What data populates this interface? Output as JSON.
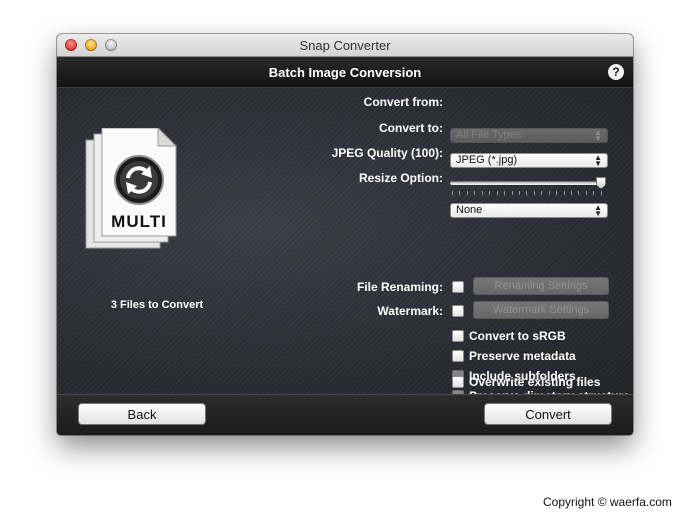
{
  "window": {
    "title": "Snap Converter"
  },
  "header": {
    "title": "Batch Image Conversion",
    "help_label": "?"
  },
  "form": {
    "convert_from": {
      "label": "Convert from:",
      "value": "All File Types"
    },
    "convert_to": {
      "label": "Convert to:",
      "value": "JPEG (*.jpg)"
    },
    "jpeg_quality": {
      "label": "JPEG Quality (100):",
      "value": 100
    },
    "resize_option": {
      "label": "Resize Option:",
      "value": "None"
    },
    "file_renaming": {
      "label": "File Renaming:",
      "button": "Renaming Settings",
      "checked": false
    },
    "watermark": {
      "label": "Watermark:",
      "button": "Watermark Settings",
      "checked": false
    },
    "options": [
      {
        "label": "Convert to sRGB",
        "checked": false,
        "enabled": true
      },
      {
        "label": "Preserve metadata",
        "checked": false,
        "enabled": true
      },
      {
        "label": "Include subfolders",
        "checked": false,
        "enabled": false
      },
      {
        "label": "Preserve directory structure",
        "checked": false,
        "enabled": false
      },
      {
        "label": "Overwrite existing files",
        "checked": false,
        "enabled": true
      }
    ]
  },
  "files": {
    "icon_label": "MULTI",
    "count_text": "3 Files to Convert"
  },
  "footer": {
    "back_label": "Back",
    "convert_label": "Convert"
  },
  "copyright": "Copyright © waerfa.com",
  "colors": {
    "panel": "#2c2d35",
    "header": "#1a1a1a",
    "text": "#ffffff"
  }
}
